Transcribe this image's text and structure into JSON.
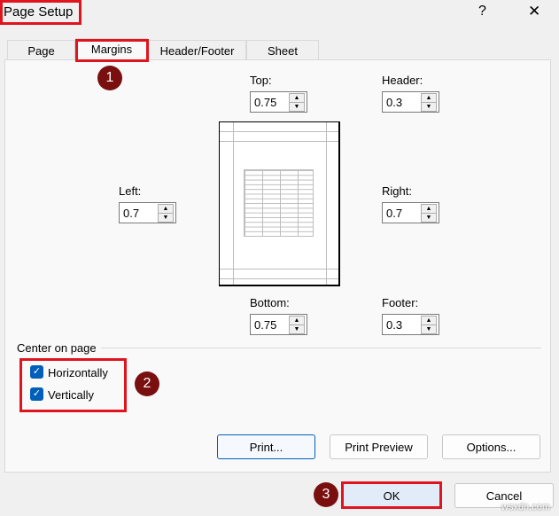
{
  "window": {
    "title": "Page Setup",
    "help": "?",
    "close": "✕"
  },
  "tabs": [
    "Page",
    "Margins",
    "Header/Footer",
    "Sheet"
  ],
  "fields": {
    "top": {
      "label": "Top:",
      "value": "0.75"
    },
    "header": {
      "label": "Header:",
      "value": "0.3"
    },
    "left": {
      "label": "Left:",
      "value": "0.7"
    },
    "right": {
      "label": "Right:",
      "value": "0.7"
    },
    "bottom": {
      "label": "Bottom:",
      "value": "0.75"
    },
    "footer": {
      "label": "Footer:",
      "value": "0.3"
    }
  },
  "center": {
    "heading": "Center on page",
    "horizontally": "Horizontally",
    "vertically": "Vertically",
    "horizontally_checked": true,
    "vertically_checked": true
  },
  "buttons": {
    "print": "Print...",
    "print_preview": "Print Preview",
    "options": "Options...",
    "ok": "OK",
    "cancel": "Cancel"
  },
  "steps": [
    "1",
    "2",
    "3"
  ],
  "watermark": "wsxdn.com",
  "colors": {
    "annotation": "#e0141e",
    "step": "#7a0f0f",
    "checkbox": "#005fb8"
  }
}
